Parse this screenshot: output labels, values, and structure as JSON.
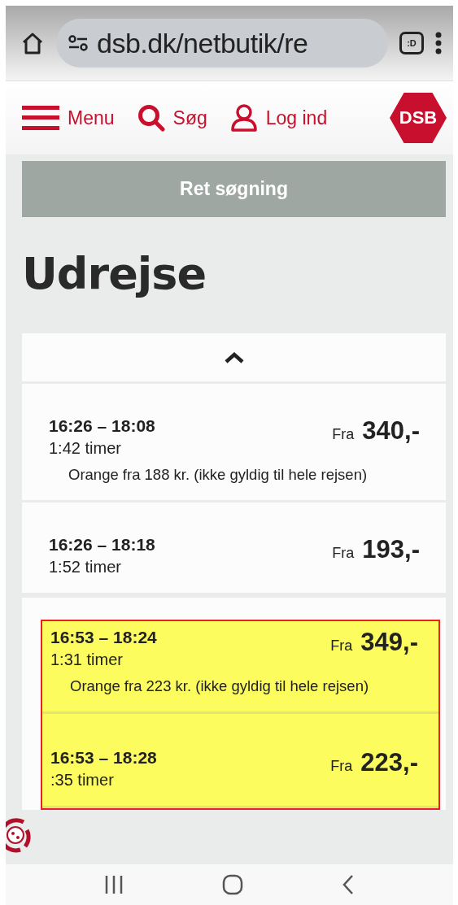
{
  "browser": {
    "url": "dsb.dk/netbutik/re",
    "tab_count": ":D"
  },
  "nav": {
    "items": [
      {
        "kind": "menu",
        "label": "Menu"
      },
      {
        "kind": "search",
        "label": "Søg"
      },
      {
        "kind": "user",
        "label": "Log ind"
      }
    ],
    "logo": "DSB"
  },
  "refine_button": "Ret søgning",
  "heading": "Udrejse",
  "journeys": [
    {
      "times": "16:26 – 18:08",
      "duration": "1:42 timer",
      "from_label": "Fra",
      "price": "340,-",
      "note": "Orange fra 188 kr. (ikke gyldig til hele rejsen)",
      "highlighted": false
    },
    {
      "times": "16:26 – 18:18",
      "duration": "1:52 timer",
      "from_label": "Fra",
      "price": "193,-",
      "highlighted": false
    },
    {
      "times": "16:53 – 18:24",
      "duration": "1:31 timer",
      "from_label": "Fra",
      "price": "349,-",
      "note": "Orange fra 223 kr. (ikke gyldig til hele rejsen)",
      "highlighted": true
    },
    {
      "times": "16:53 – 18:28",
      "duration": ":35 timer",
      "from_label": "Fra",
      "price": "223,-",
      "highlighted": true
    }
  ]
}
